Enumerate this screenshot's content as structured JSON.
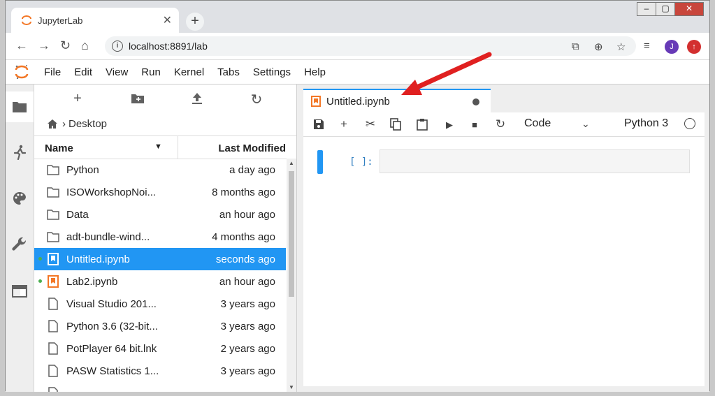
{
  "browser": {
    "tab_title": "JupyterLab",
    "tab_close": "✕",
    "new_tab": "+",
    "url": "localhost:8891/lab",
    "profile_initial": "J",
    "window_controls": [
      "–",
      "▢",
      "✕"
    ]
  },
  "menu": {
    "items": [
      "File",
      "Edit",
      "View",
      "Run",
      "Kernel",
      "Tabs",
      "Settings",
      "Help"
    ]
  },
  "sidebar": {
    "icons": [
      "folder-icon",
      "running-icon",
      "palette-icon",
      "wrench-icon",
      "tabs-icon"
    ]
  },
  "filebrowser": {
    "breadcrumb": "Desktop",
    "col_name": "Name",
    "col_modified": "Last Modified",
    "files": [
      {
        "name": "Python",
        "modified": "a day ago",
        "type": "folder",
        "running": false,
        "selected": false
      },
      {
        "name": "ISOWorkshopNoi...",
        "modified": "8 months ago",
        "type": "folder",
        "running": false,
        "selected": false
      },
      {
        "name": "Data",
        "modified": "an hour ago",
        "type": "folder",
        "running": false,
        "selected": false
      },
      {
        "name": "adt-bundle-wind...",
        "modified": "4 months ago",
        "type": "folder",
        "running": false,
        "selected": false
      },
      {
        "name": "Untitled.ipynb",
        "modified": "seconds ago",
        "type": "notebook",
        "running": true,
        "selected": true
      },
      {
        "name": "Lab2.ipynb",
        "modified": "an hour ago",
        "type": "notebook",
        "running": true,
        "selected": false
      },
      {
        "name": "Visual Studio 201...",
        "modified": "3 years ago",
        "type": "file",
        "running": false,
        "selected": false
      },
      {
        "name": "Python 3.6 (32-bit...",
        "modified": "3 years ago",
        "type": "file",
        "running": false,
        "selected": false
      },
      {
        "name": "PotPlayer 64 bit.lnk",
        "modified": "2 years ago",
        "type": "file",
        "running": false,
        "selected": false
      },
      {
        "name": "PASW Statistics 1...",
        "modified": "3 years ago",
        "type": "file",
        "running": false,
        "selected": false
      },
      {
        "name": "",
        "modified": "",
        "type": "file",
        "running": false,
        "selected": false
      }
    ]
  },
  "notebook": {
    "tab_title": "Untitled.ipynb",
    "cell_type": "Code",
    "kernel": "Python 3",
    "prompt": "[ ]:"
  },
  "colors": {
    "accent": "#2196f3",
    "jupyter_orange": "#f37726",
    "running_green": "#4caf50"
  }
}
